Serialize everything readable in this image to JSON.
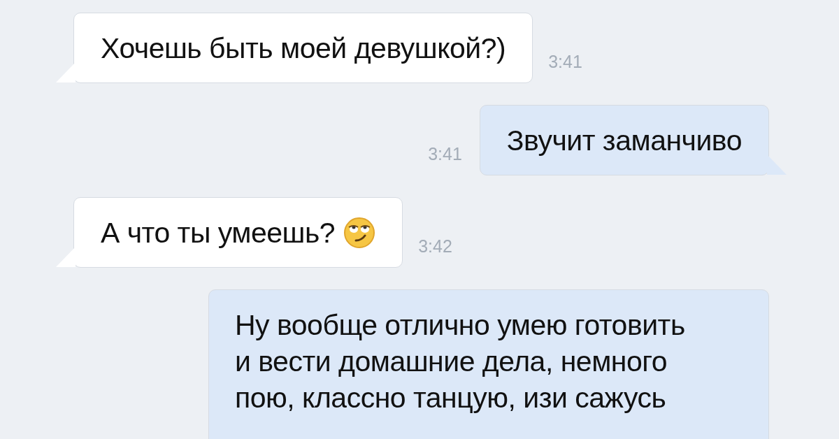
{
  "messages": [
    {
      "kind": "incoming",
      "lines": [
        "Хочешь быть моей девушкой?)"
      ],
      "time": "3:41"
    },
    {
      "kind": "outgoing",
      "lines": [
        "Звучит заманчиво"
      ],
      "time": "3:41"
    },
    {
      "kind": "incoming",
      "lines": [
        "А что ты умеешь?"
      ],
      "emoji": true,
      "time": "3:42"
    },
    {
      "kind": "outgoing",
      "lines": [
        "Ну вообще отлично умею готовить",
        "и вести домашние дела, немного",
        "пою, классно танцую, изи сажусь"
      ]
    }
  ]
}
